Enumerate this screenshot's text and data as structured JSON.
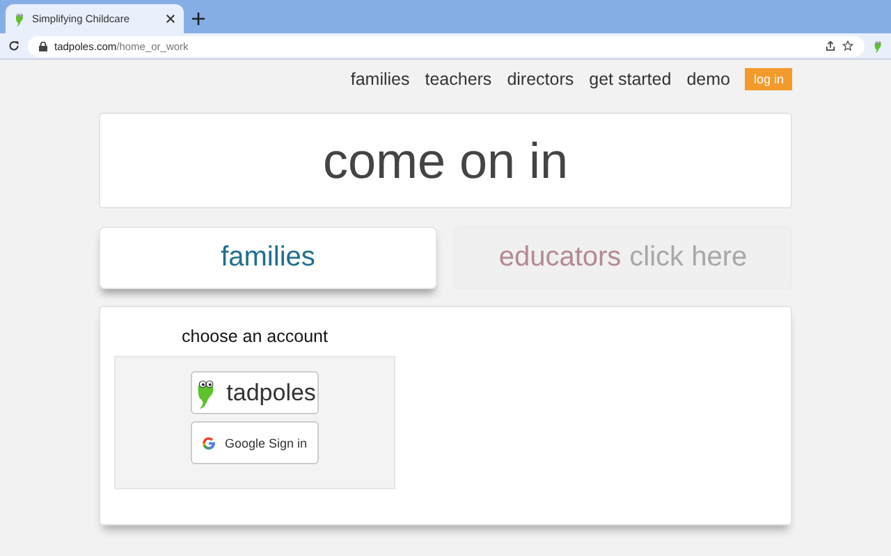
{
  "browser": {
    "tab_title": "Simplifying Childcare",
    "url_host": "tadpoles.com",
    "url_path": "/home_or_work"
  },
  "nav": {
    "links": [
      "families",
      "teachers",
      "directors",
      "get started",
      "demo"
    ],
    "login": "log in"
  },
  "hero": {
    "title": "come on in"
  },
  "tabs": [
    {
      "label": "families",
      "selected": true
    },
    {
      "label": "educators",
      "hint": "click here",
      "selected": false
    }
  ],
  "account": {
    "heading": "choose an account",
    "buttons": [
      {
        "kind": "tadpoles",
        "label": "tadpoles"
      },
      {
        "kind": "google",
        "label": "Google Sign in"
      }
    ]
  }
}
